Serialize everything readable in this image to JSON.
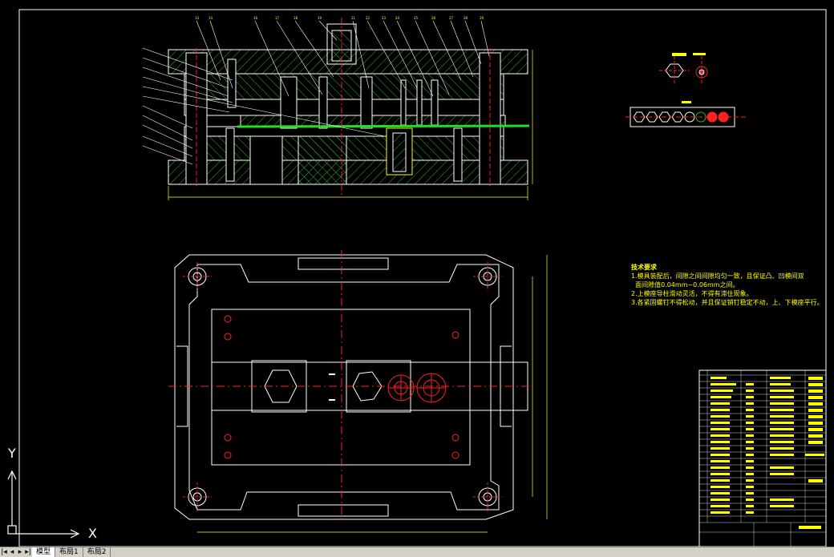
{
  "ucs": {
    "x_label": "X",
    "y_label": "Y"
  },
  "tabs": [
    {
      "label": "模型"
    },
    {
      "label": "布局1"
    },
    {
      "label": "布局2"
    }
  ],
  "colors": {
    "background": "#000000",
    "outline": "#ffffff",
    "hatch": "#2db52d",
    "center": "#ff2020",
    "dimension": "#ffff00",
    "parting_line": "#21e021",
    "frame": "#ffffff"
  }
}
